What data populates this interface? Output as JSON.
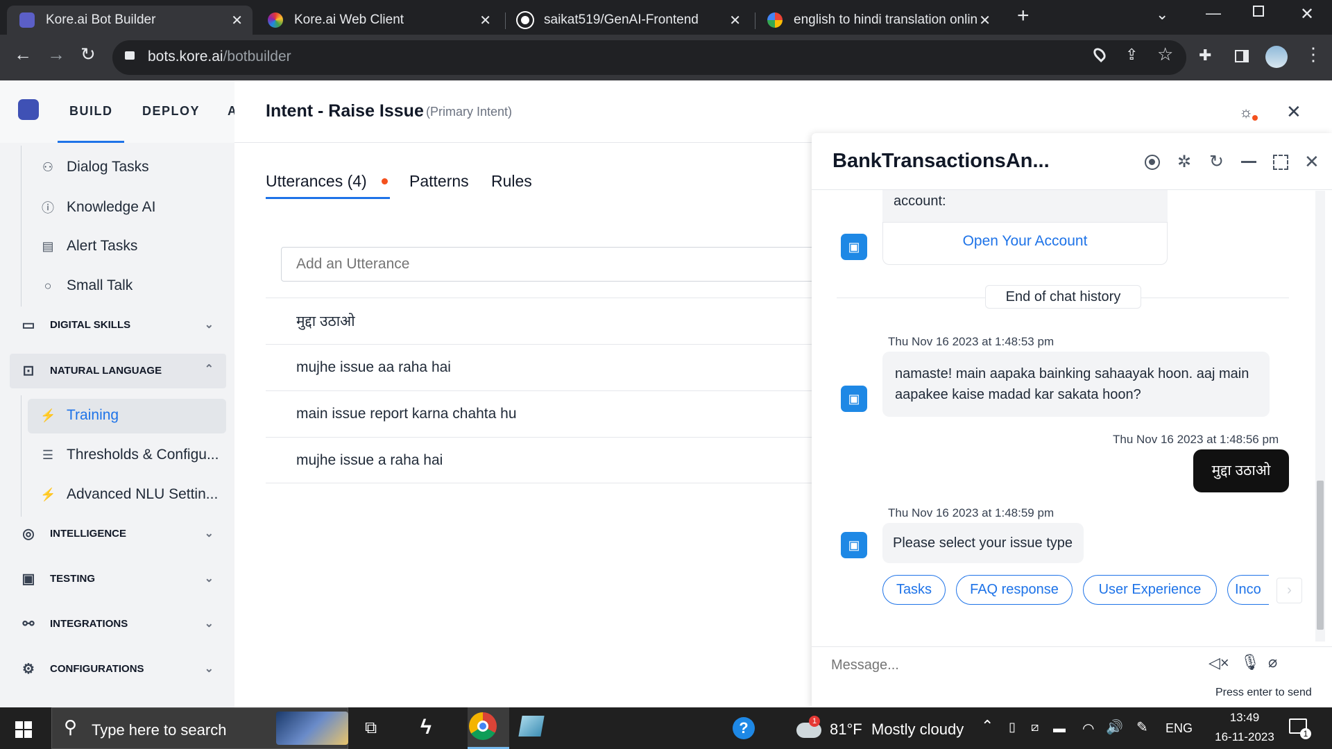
{
  "browser": {
    "tabs": [
      {
        "label": "Kore.ai Bot Builder",
        "icon": "kore-bot-builder-icon",
        "active": true
      },
      {
        "label": "Kore.ai Web Client",
        "icon": "kore-web-client-icon",
        "active": false
      },
      {
        "label": "saikat519/GenAI-Frontend",
        "icon": "github-icon",
        "active": false
      },
      {
        "label": "english to hindi translation onlin",
        "icon": "google-icon",
        "active": false
      }
    ],
    "url_host": "bots.kore.ai",
    "url_path": "/botbuilder"
  },
  "topnav": {
    "build": "BUILD",
    "deploy": "DEPLOY",
    "analyze_partial": "A"
  },
  "sidebar": {
    "sub_items": [
      {
        "label": "Dialog Tasks",
        "icon": "dialog-tasks-icon"
      },
      {
        "label": "Knowledge AI",
        "icon": "knowledge-ai-icon"
      },
      {
        "label": "Alert Tasks",
        "icon": "alert-tasks-icon"
      },
      {
        "label": "Small Talk",
        "icon": "small-talk-icon"
      }
    ],
    "digital_skills": "DIGITAL SKILLS",
    "natural_language": "NATURAL LANGUAGE",
    "nl_items": [
      {
        "label": "Training",
        "icon": "training-icon",
        "selected": true
      },
      {
        "label": "Thresholds & Configu...",
        "icon": "thresholds-icon",
        "selected": false
      },
      {
        "label": "Advanced NLU Settin...",
        "icon": "advanced-nlu-icon",
        "selected": false
      }
    ],
    "sections": [
      {
        "label": "INTELLIGENCE",
        "icon": "intelligence-icon"
      },
      {
        "label": "TESTING",
        "icon": "testing-icon"
      },
      {
        "label": "INTEGRATIONS",
        "icon": "integrations-icon"
      },
      {
        "label": "CONFIGURATIONS",
        "icon": "configurations-icon"
      }
    ]
  },
  "intent": {
    "title": "Intent - Raise Issue",
    "subtitle": "(Primary Intent)",
    "tabs": [
      "Utterances (4)",
      "Patterns",
      "Rules"
    ],
    "utterance_placeholder": "Add an Utterance",
    "utterances": [
      "मुद्दा उठाओ",
      "mujhe issue aa raha hai",
      "main issue report karna chahta hu",
      "mujhe issue a raha hai"
    ]
  },
  "chat": {
    "title": "BankTransactionsAn...",
    "prev_text": "account:",
    "open_account_button": "Open Your Account",
    "end_history": "End of chat history",
    "messages": [
      {
        "timestamp": "Thu Nov 16 2023 at 1:48:53 pm",
        "text": "namaste! main aapaka bainking sahaayak hoon. aaj main aapakee kaise madad kar sakata hoon?"
      },
      {
        "timestamp": "Thu Nov 16 2023 at 1:48:56 pm",
        "text": "मुद्दा उठाओ"
      },
      {
        "timestamp": "Thu Nov 16 2023 at 1:48:59 pm",
        "text": "Please select your issue type"
      }
    ],
    "quick_replies": [
      "Tasks",
      "FAQ response",
      "User Experience",
      "Inco"
    ],
    "input_placeholder": "Message...",
    "send_hint": "Press enter to send"
  },
  "taskbar": {
    "search_placeholder": "Type here to search",
    "weather_temp": "81°F",
    "weather_text": "Mostly cloudy",
    "weather_badge": "1",
    "language": "ENG",
    "time": "13:49",
    "date": "16-11-2023",
    "notification_count": "1"
  },
  "colors": {
    "accent": "#1e73e8",
    "notification_dot": "#f4511e",
    "bot_avatar": "#1e88e5"
  }
}
